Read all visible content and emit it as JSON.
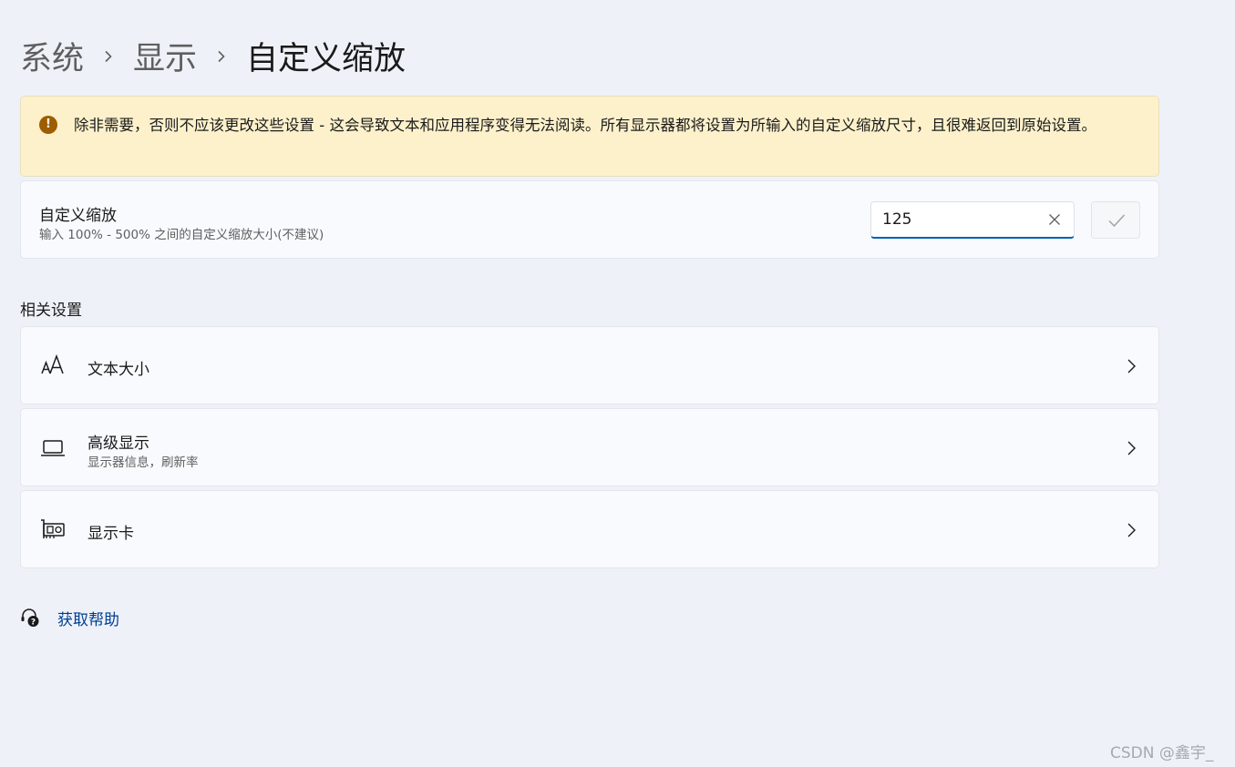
{
  "breadcrumb": {
    "items": [
      "系统",
      "显示",
      "自定义缩放"
    ]
  },
  "warning": {
    "icon": "warning-icon",
    "text": "除非需要，否则不应该更改这些设置 - 这会导致文本和应用程序变得无法阅读。所有显示器都将设置为所输入的自定义缩放尺寸，且很难返回到原始设置。"
  },
  "custom_scaling": {
    "title": "自定义缩放",
    "subtitle": "输入 100% - 500% 之间的自定义缩放大小(不建议)",
    "input_value": "125"
  },
  "related": {
    "heading": "相关设置",
    "items": [
      {
        "icon": "text-size-icon",
        "title": "文本大小",
        "subtitle": ""
      },
      {
        "icon": "laptop-icon",
        "title": "高级显示",
        "subtitle": "显示器信息，刷新率"
      },
      {
        "icon": "graphics-card-icon",
        "title": "显示卡",
        "subtitle": ""
      }
    ]
  },
  "help": {
    "icon": "help-icon",
    "label": "获取帮助"
  },
  "watermark": "CSDN @鑫宇_",
  "colors": {
    "background": "#eef2f8",
    "warning_bg": "#fdf1cb",
    "warning_icon": "#9d5d00",
    "accent": "#005fb8",
    "link": "#003e92"
  }
}
